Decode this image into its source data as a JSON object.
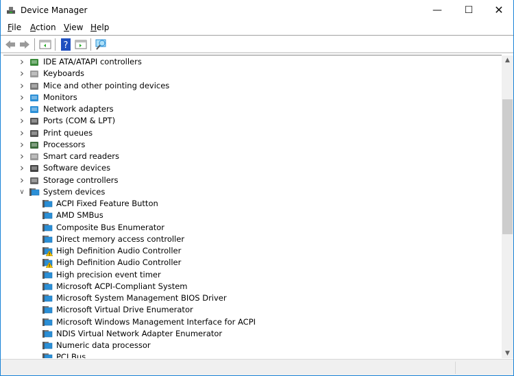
{
  "window": {
    "title": "Device Manager",
    "accent": "#1883d7"
  },
  "menu": [
    {
      "label": "File",
      "key": "F",
      "rest": "ile"
    },
    {
      "label": "Action",
      "key": "A",
      "rest": "ction"
    },
    {
      "label": "View",
      "key": "V",
      "rest": "iew"
    },
    {
      "label": "Help",
      "key": "H",
      "rest": "elp"
    }
  ],
  "toolbar": [
    "back-icon",
    "forward-icon",
    "show-hide-console-tree-icon",
    "help-icon",
    "action-pane-icon",
    "scan-hardware-icon"
  ],
  "tree": {
    "categories": [
      {
        "label": "IDE ATA/ATAPI controllers",
        "icon": "ide-controller-icon",
        "color": "#3a8a3a"
      },
      {
        "label": "Keyboards",
        "icon": "keyboard-icon",
        "color": "#9a9a9a"
      },
      {
        "label": "Mice and other pointing devices",
        "icon": "mouse-icon",
        "color": "#777777"
      },
      {
        "label": "Monitors",
        "icon": "monitor-icon",
        "color": "#2b8fd6"
      },
      {
        "label": "Network adapters",
        "icon": "network-adapter-icon",
        "color": "#2b8fd6"
      },
      {
        "label": "Ports (COM & LPT)",
        "icon": "port-icon",
        "color": "#555555"
      },
      {
        "label": "Print queues",
        "icon": "printer-icon",
        "color": "#555555"
      },
      {
        "label": "Processors",
        "icon": "processor-icon",
        "color": "#3d6b3d"
      },
      {
        "label": "Smart card readers",
        "icon": "smart-card-reader-icon",
        "color": "#999999"
      },
      {
        "label": "Software devices",
        "icon": "software-device-icon",
        "color": "#444444"
      },
      {
        "label": "Storage controllers",
        "icon": "storage-controller-icon",
        "color": "#666666"
      },
      {
        "label": "System devices",
        "icon": "system-devices-icon",
        "color": "#2b8fd6",
        "expanded": true
      }
    ],
    "system_devices": [
      {
        "label": "ACPI Fixed Feature Button"
      },
      {
        "label": "AMD SMBus"
      },
      {
        "label": "Composite Bus Enumerator"
      },
      {
        "label": "Direct memory access controller"
      },
      {
        "label": "High Definition Audio Controller",
        "warning": true
      },
      {
        "label": "High Definition Audio Controller",
        "warning": true
      },
      {
        "label": "High precision event timer"
      },
      {
        "label": "Microsoft ACPI-Compliant System"
      },
      {
        "label": "Microsoft System Management BIOS Driver"
      },
      {
        "label": "Microsoft Virtual Drive Enumerator"
      },
      {
        "label": "Microsoft Windows Management Interface for ACPI"
      },
      {
        "label": "NDIS Virtual Network Adapter Enumerator"
      },
      {
        "label": "Numeric data processor"
      },
      {
        "label": "PCI Bus"
      }
    ]
  }
}
